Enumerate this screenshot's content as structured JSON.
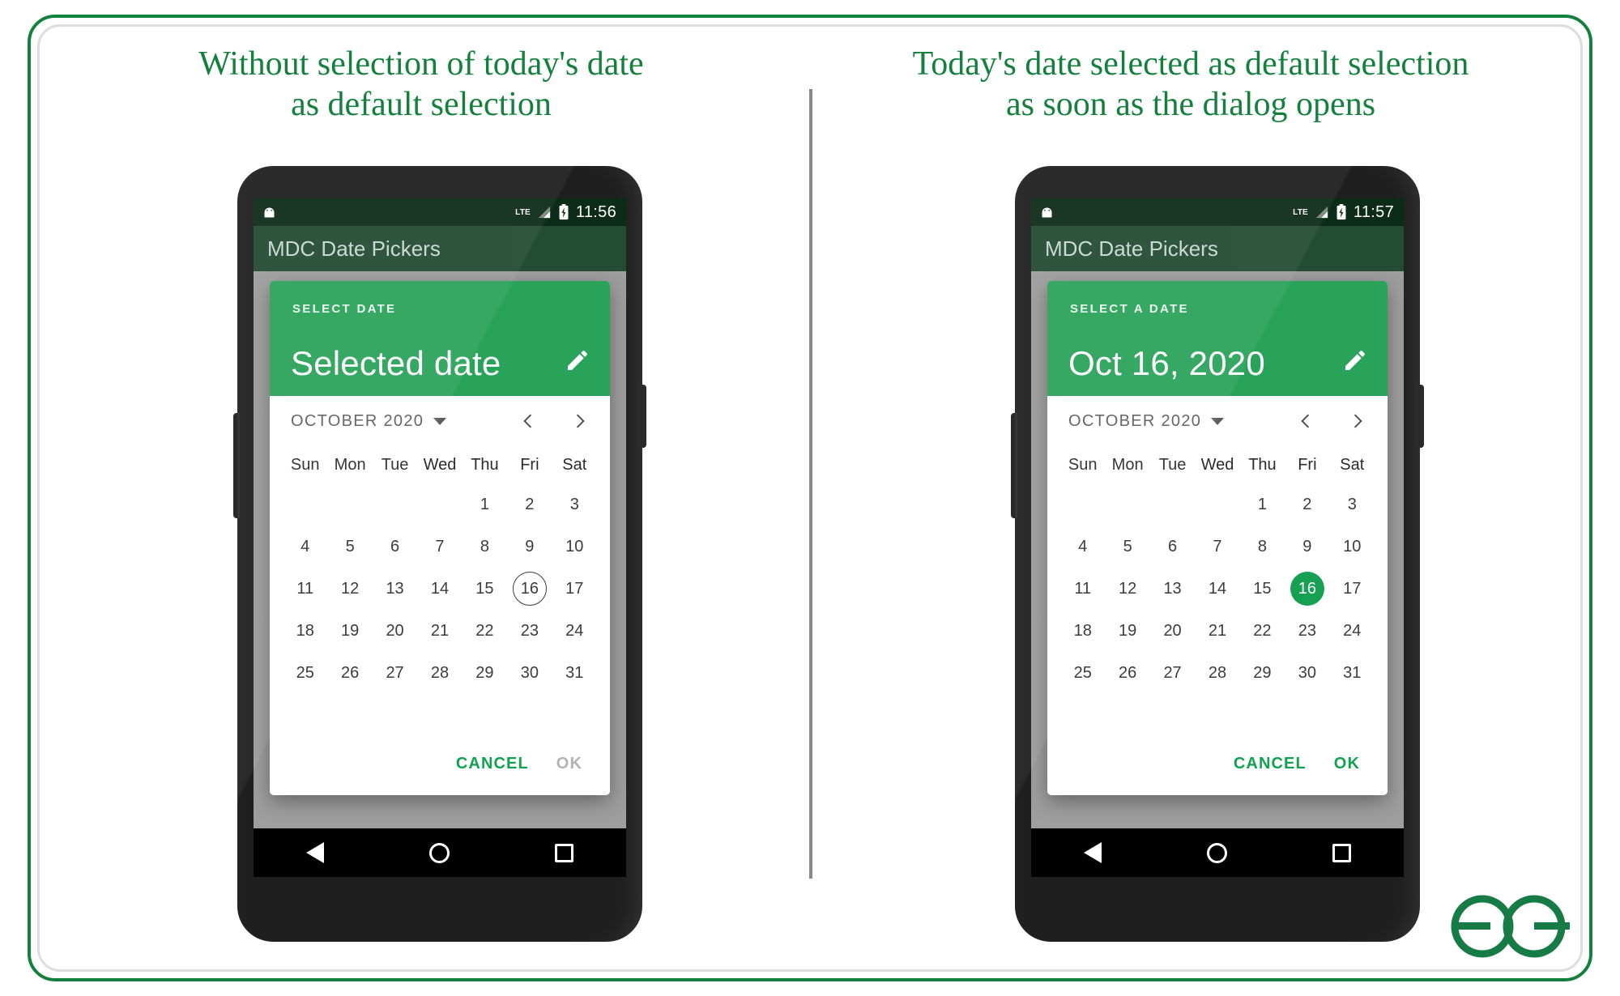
{
  "panels": [
    {
      "id": "left",
      "heading": "Without selection of today's date as default selection",
      "heading_line1": "Without selection of today's date",
      "heading_line2": "as default selection",
      "status_bar": {
        "time": "11:56",
        "network": "LTE",
        "android_icon": "android-head-icon",
        "battery_icon": "battery-icon",
        "signal_icon": "signal-icon"
      },
      "app_bar_title": "MDC Date Pickers",
      "dialog": {
        "overline": "SELECT DATE",
        "title": "Selected date",
        "edit_icon": "pencil-icon",
        "month_label": "OCTOBER 2020",
        "dropdown_icon": "chevron-down-icon",
        "prev_icon": "chevron-left-icon",
        "next_icon": "chevron-right-icon",
        "weekdays": [
          "Sun",
          "Mon",
          "Tue",
          "Wed",
          "Thu",
          "Fri",
          "Sat"
        ],
        "weeks": [
          [
            "",
            "",
            "",
            "",
            "1",
            "2",
            "3"
          ],
          [
            "4",
            "5",
            "6",
            "7",
            "8",
            "9",
            "10"
          ],
          [
            "11",
            "12",
            "13",
            "14",
            "15",
            "16",
            "17"
          ],
          [
            "18",
            "19",
            "20",
            "21",
            "22",
            "23",
            "24"
          ],
          [
            "25",
            "26",
            "27",
            "28",
            "29",
            "30",
            "31"
          ]
        ],
        "today": "16",
        "selected": null,
        "cancel_label": "CANCEL",
        "ok_label": "OK",
        "ok_enabled": false
      },
      "nav_bar": {
        "back_icon": "back-triangle-icon",
        "home_icon": "home-circle-icon",
        "recents_icon": "recents-square-icon"
      }
    },
    {
      "id": "right",
      "heading": "Today's date selected as default selection as soon as the dialog opens",
      "heading_line1": "Today's date selected as default selection",
      "heading_line2": "as soon as the dialog opens",
      "status_bar": {
        "time": "11:57",
        "network": "LTE",
        "android_icon": "android-head-icon",
        "battery_icon": "battery-icon",
        "signal_icon": "signal-icon"
      },
      "app_bar_title": "MDC Date Pickers",
      "dialog": {
        "overline": "SELECT A DATE",
        "title": "Oct 16, 2020",
        "edit_icon": "pencil-icon",
        "month_label": "OCTOBER 2020",
        "dropdown_icon": "chevron-down-icon",
        "prev_icon": "chevron-left-icon",
        "next_icon": "chevron-right-icon",
        "weekdays": [
          "Sun",
          "Mon",
          "Tue",
          "Wed",
          "Thu",
          "Fri",
          "Sat"
        ],
        "weeks": [
          [
            "",
            "",
            "",
            "",
            "1",
            "2",
            "3"
          ],
          [
            "4",
            "5",
            "6",
            "7",
            "8",
            "9",
            "10"
          ],
          [
            "11",
            "12",
            "13",
            "14",
            "15",
            "16",
            "17"
          ],
          [
            "18",
            "19",
            "20",
            "21",
            "22",
            "23",
            "24"
          ],
          [
            "25",
            "26",
            "27",
            "28",
            "29",
            "30",
            "31"
          ]
        ],
        "today": "16",
        "selected": "16",
        "cancel_label": "CANCEL",
        "ok_label": "OK",
        "ok_enabled": true
      },
      "nav_bar": {
        "back_icon": "back-triangle-icon",
        "home_icon": "home-circle-icon",
        "recents_icon": "recents-square-icon"
      }
    }
  ],
  "branding": {
    "logo": "geeksforgeeks-logo",
    "logo_color": "#177b45"
  },
  "colors": {
    "frame_border": "#15803d",
    "heading_text": "#15803d",
    "dialog_header": "#2aa35a",
    "selected_day": "#17a053",
    "action_enabled": "#12a150",
    "action_disabled": "#b3b3b3",
    "status_bar": "#0d2b19",
    "app_bar": "#0e3d22"
  }
}
